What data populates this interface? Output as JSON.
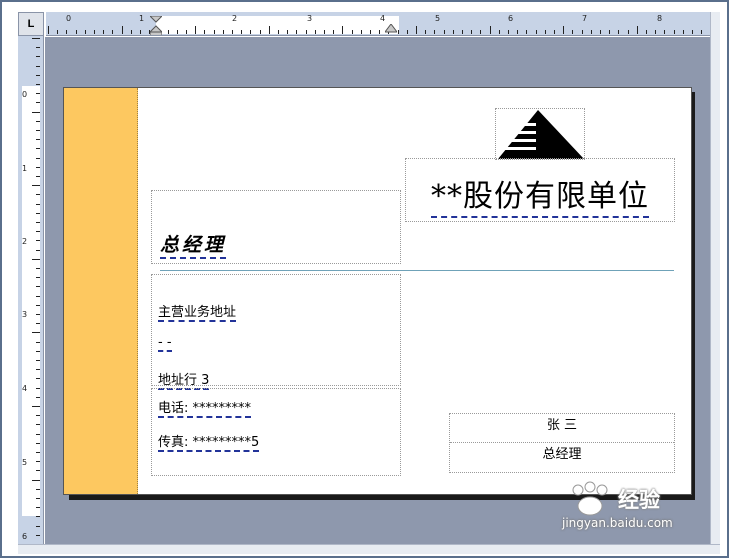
{
  "ruler": {
    "corner_label": "L",
    "h_numbers": [
      "0",
      "1",
      "1",
      "2",
      "3",
      "4",
      "5",
      "6",
      "7",
      "8"
    ],
    "v_numbers": [
      "0",
      "1",
      "2",
      "3",
      "4",
      "5",
      "6"
    ]
  },
  "card": {
    "company_name": "**股份有限单位",
    "job_title": "总经理",
    "address_line1": "主营业务地址",
    "address_line2": "- -",
    "address_line3": "地址行 3",
    "phone": "电话: *********",
    "fax": "传真: *********5",
    "person_name": "张  三",
    "person_title": "总经理",
    "colors": {
      "sidebar": "#fdc860",
      "divider": "#6fa2b8",
      "workspace": "#8e98ad"
    },
    "logo_icon": "stepped-triangle-logo-icon"
  },
  "watermark": {
    "brand": "经验",
    "url": "jingyan.baidu.com"
  }
}
